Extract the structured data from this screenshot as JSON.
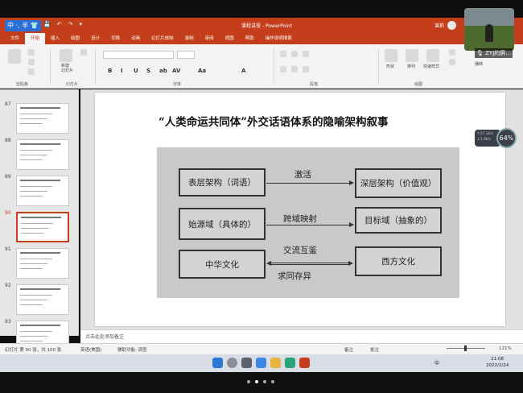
{
  "window": {
    "title": "课程讲授 - PowerPoint",
    "user": "谌莉",
    "ime": "中 ·, 半 👕"
  },
  "tabs": [
    "文件",
    "开始",
    "插入",
    "绘图",
    "设计",
    "切换",
    "动画",
    "幻灯片放映",
    "录制",
    "审阅",
    "视图",
    "帮助",
    "操作说明搜索"
  ],
  "active_tab": "开始",
  "ribbon": {
    "groups": [
      "剪贴板",
      "幻灯片",
      "字体",
      "段落",
      "绘图"
    ],
    "new_slide": "新建\n幻灯片",
    "format_buttons": [
      "B",
      "I",
      "U",
      "S",
      "ab",
      "AV",
      "Aa",
      "A"
    ],
    "right_buttons": [
      "形状",
      "排列",
      "快速样式"
    ]
  },
  "video_overlay": {
    "label": "ZYJ的屏...",
    "sublabel": "播映"
  },
  "thumbnails": [
    {
      "num": "87"
    },
    {
      "num": "88"
    },
    {
      "num": "89"
    },
    {
      "num": "90",
      "selected": true
    },
    {
      "num": "91"
    },
    {
      "num": "92"
    },
    {
      "num": "93"
    }
  ],
  "slide": {
    "title": "“人类命运共同体”外交话语体系的隐喻架构叙事",
    "diagram": {
      "rows": [
        {
          "left": "表层架构（词语）",
          "middle": "激活",
          "right": "深层架构（价值观）"
        },
        {
          "left": "始源域（具体的）",
          "middle": "跨域映射",
          "right": "目标域（抽象的）"
        },
        {
          "left": "中华文化",
          "middle_top": "交流互鉴",
          "middle_bottom": "求同存异",
          "right": "西方文化"
        }
      ]
    }
  },
  "network": {
    "up": "↑27.2k/s",
    "down": "↓1.9k/s",
    "cpu": "64%"
  },
  "notes_placeholder": "点击此处添加备注",
  "status": {
    "slide_count": "幻灯片 第 90 张，共 100 张",
    "language": "英语(美国)",
    "accessibility": "辅助功能: 调查",
    "notes": "备注",
    "comments": "批注",
    "zoom": "121%"
  },
  "taskbar": {
    "time": "21:08",
    "date": "2022/2/24",
    "ime": "中"
  }
}
